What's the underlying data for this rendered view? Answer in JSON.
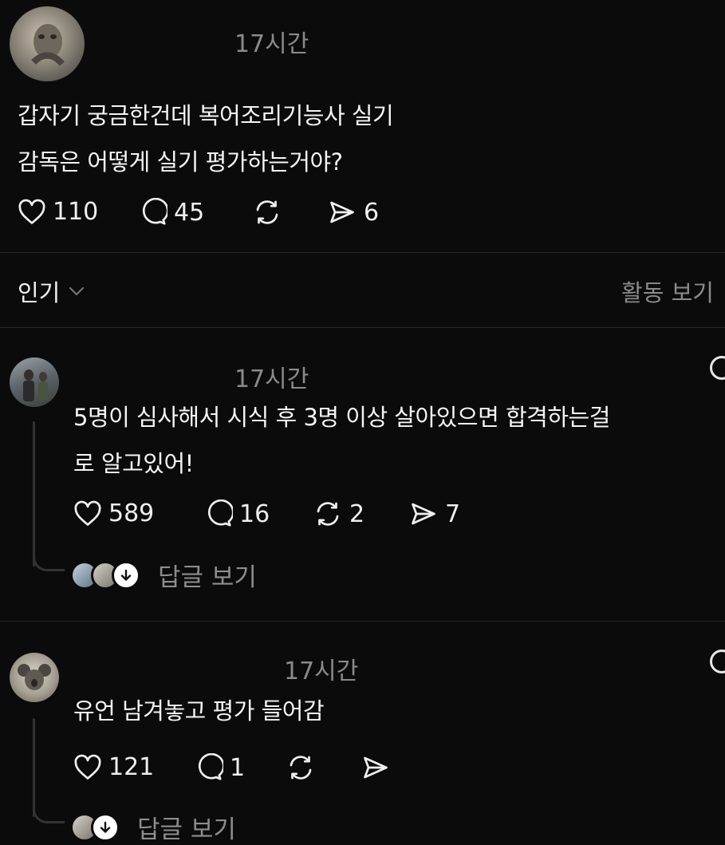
{
  "post": {
    "time": "17시간",
    "text_line1": "갑자기 궁금한건데 복어조리기능사 실기",
    "text_line2": "감독은 어떻게 실기 평가하는거야?",
    "likes": "110",
    "comments": "45",
    "shares": "6"
  },
  "filter": {
    "label": "인기",
    "activity_link": "활동 보기"
  },
  "comments": [
    {
      "time": "17시간",
      "text_line1": "5명이 심사해서 시식 후 3명 이상 살아있으면 합격하는걸",
      "text_line2": "로 알고있어!",
      "likes": "589",
      "comments": "16",
      "reposts": "2",
      "shares": "7",
      "view_replies": "답글 보기"
    },
    {
      "time": "17시간",
      "text_line1": "유언 남겨놓고 평가 들어감",
      "likes": "121",
      "comments": "1",
      "view_replies": "답글 보기"
    }
  ],
  "icons": {
    "heart": "heart-icon",
    "comment": "comment-bubble-icon",
    "repost": "repost-icon",
    "share": "send-icon",
    "chevron": "chevron-down-icon",
    "arrow": "arrow-down-icon"
  }
}
